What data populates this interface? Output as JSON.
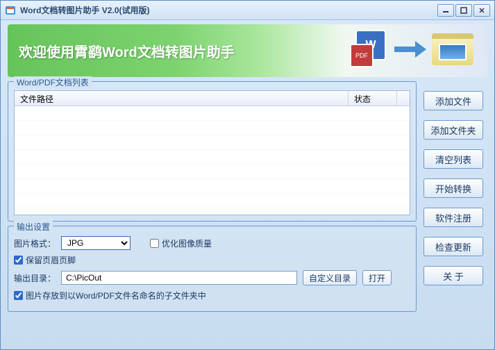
{
  "window": {
    "title": "Word文档转图片助手  V2.0(试用版)"
  },
  "banner": {
    "text": "欢迎使用霄鹞Word文档转图片助手",
    "word_label": "W",
    "pdf_label": "PDF"
  },
  "filelist": {
    "group_title": "Word/PDF文档列表",
    "col_path": "文件路径",
    "col_status": "状态"
  },
  "output": {
    "group_title": "输出设置",
    "format_label": "图片格式：",
    "format_value": "JPG",
    "optimize_quality": "优化图像质量",
    "optimize_checked": false,
    "keep_header_footer": "保留页眉页脚",
    "keep_checked": true,
    "outdir_label": "输出目录：",
    "outdir_value": "C:\\PicOut",
    "custom_dir_btn": "自定义目录",
    "open_btn": "打开",
    "subfolder_label": "图片存放到以Word/PDF文件名命名的子文件夹中",
    "subfolder_checked": true
  },
  "sidebar": {
    "add_file": "添加文件",
    "add_folder": "添加文件夹",
    "clear_list": "清空列表",
    "start_convert": "开始转换",
    "register": "软件注册",
    "check_update": "检查更新",
    "about": "关  于"
  }
}
